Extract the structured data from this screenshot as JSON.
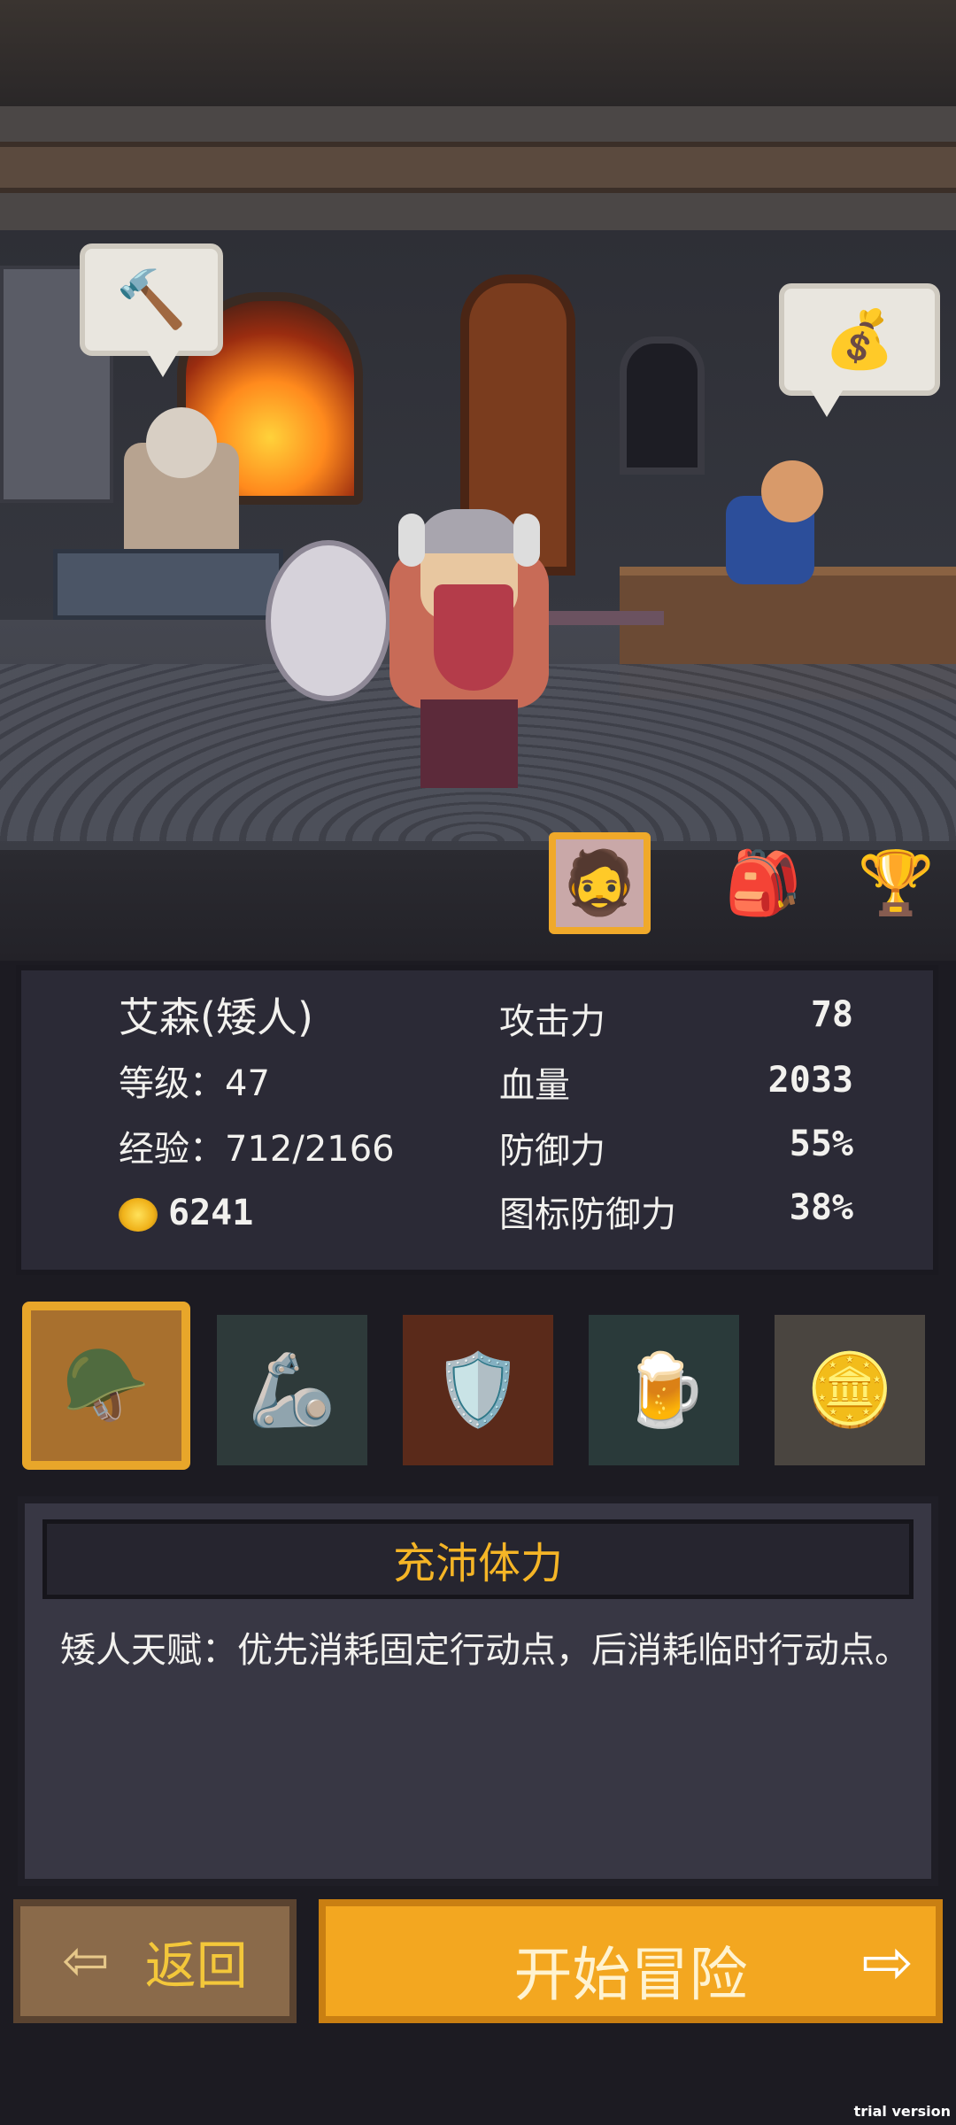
{
  "hero": {
    "name": "艾森(矮人)",
    "level_label": "等级：47",
    "exp_label": "经验：712/2166",
    "gold": "6241"
  },
  "stats": [
    {
      "label": "攻击力",
      "value": "78"
    },
    {
      "label": "血量",
      "value": "2033"
    },
    {
      "label": "防御力",
      "value": "55%"
    },
    {
      "label": "图标防御力",
      "value": "38%"
    }
  ],
  "talent": {
    "title": "充沛体力",
    "description": "矮人天赋：优先消耗固定行动点，后消耗临时行动点。"
  },
  "buttons": {
    "back": "返回",
    "start": "开始冒险"
  },
  "icons": {
    "hammer_bubble": "hammer-icon",
    "gold_bag_bubble": "gold-bag-icon",
    "hero_tab": "hero-portrait-icon",
    "bag_tab": "backpack-icon",
    "trophy_tab": "trophy-icon"
  },
  "skills": [
    "talent-helmet-icon",
    "gauntlet-icon",
    "shield-icon",
    "ale-icon",
    "gold-coins-icon"
  ],
  "watermark": "trial version",
  "colors": {
    "accent": "#f3a720",
    "title": "#f5b526",
    "panel": "#2b2a36"
  }
}
